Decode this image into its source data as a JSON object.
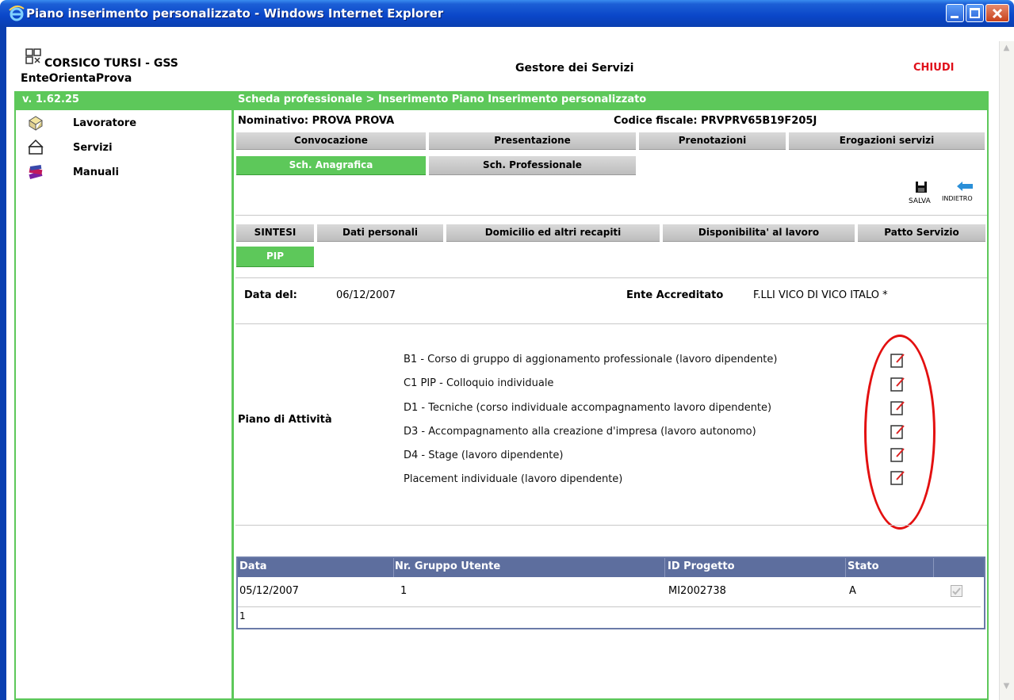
{
  "window": {
    "title": "Piano inserimento personalizzato - Windows Internet Explorer"
  },
  "header": {
    "brand": "CORSICO TURSI - GSS",
    "brand_sub": "EnteOrientaProva",
    "title": "Gestore dei Servizi",
    "close_label": "CHIUDI",
    "version": "v. 1.62.25",
    "breadcrumb": "Scheda professionale > Inserimento Piano Inserimento personalizzato"
  },
  "sidebar": {
    "items": [
      {
        "label": "Lavoratore",
        "icon": "worker-icon"
      },
      {
        "label": "Servizi",
        "icon": "services-icon"
      },
      {
        "label": "Manuali",
        "icon": "manuals-icon"
      }
    ]
  },
  "person": {
    "nominativo_label": "Nominativo:",
    "nominativo": "PROVA  PROVA",
    "cf_label": "Codice fiscale:",
    "cf": "PRVPRV65B19F205J"
  },
  "tabs_top": [
    {
      "label": "Convocazione"
    },
    {
      "label": "Presentazione"
    },
    {
      "label": "Prenotazioni"
    },
    {
      "label": "Erogazioni servizi"
    },
    {
      "label": "Sch. Anagrafica",
      "active": true
    },
    {
      "label": "Sch. Professionale"
    }
  ],
  "toolbar": {
    "save_label": "SALVA",
    "back_label": "INDIETRO"
  },
  "tabs_sub": [
    {
      "label": "SINTESI"
    },
    {
      "label": "Dati personali"
    },
    {
      "label": "Domicilio ed altri recapiti"
    },
    {
      "label": "Disponibilita' al lavoro"
    },
    {
      "label": "Patto Servizio"
    },
    {
      "label": "PIP",
      "active": true
    }
  ],
  "form": {
    "data_label": "Data del:",
    "data_value": "06/12/2007",
    "ente_label": "Ente Accreditato",
    "ente_value": "F.LLI VICO DI VICO ITALO *",
    "piano_label": "Piano di Attività",
    "activities": [
      "B1 - Corso di gruppo di aggionamento professionale (lavoro dipendente)",
      "C1 PIP - Colloquio individuale",
      "D1 - Tecniche (corso individuale accompagnamento lavoro dipendente)",
      "D3 - Accompagnamento alla creazione d'impresa (lavoro autonomo)",
      "D4 - Stage (lavoro dipendente)",
      "Placement individuale (lavoro dipendente)"
    ]
  },
  "table": {
    "columns": [
      "Data",
      "Nr. Gruppo Utente",
      "ID Progetto",
      "Stato"
    ],
    "rows": [
      {
        "data": "05/12/2007",
        "gruppo": "1",
        "progetto": "MI2002738",
        "stato": "A",
        "checked": true
      }
    ],
    "pager": "1"
  },
  "colors": {
    "accent_green": "#5dc85a",
    "table_header": "#5d6e9e",
    "close_red": "#e0101a",
    "annotation_red": "#e31010"
  }
}
